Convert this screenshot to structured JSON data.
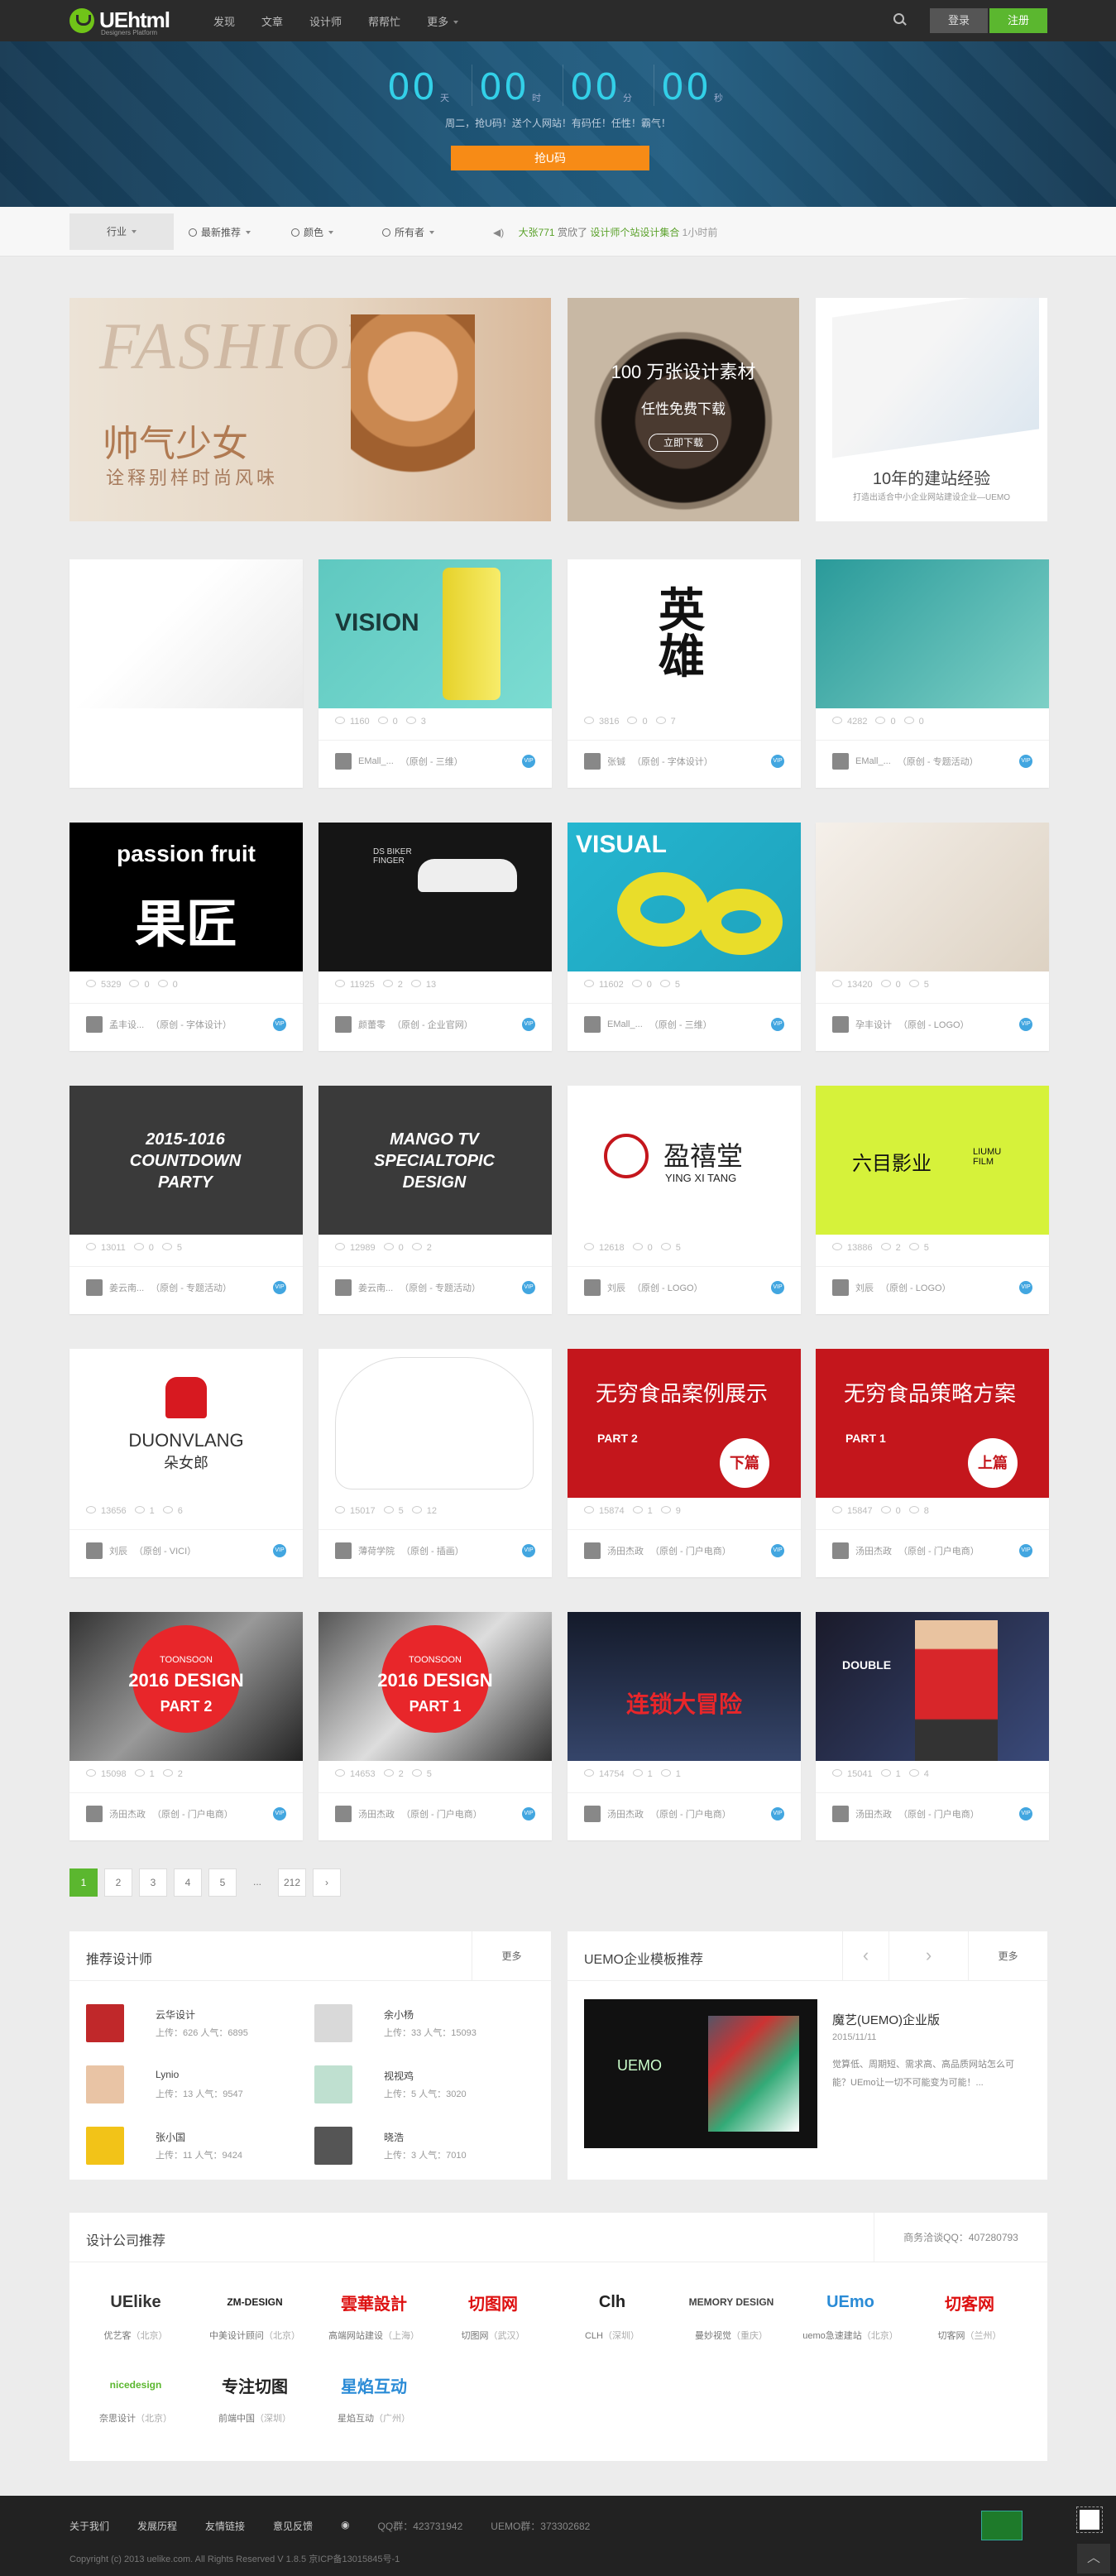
{
  "nav": {
    "logo": "UEhtml",
    "logo_sub": "Designers Platform",
    "items": [
      "发现",
      "文章",
      "设计师",
      "帮帮忙",
      "更多"
    ],
    "login": "登录",
    "register": "注册"
  },
  "banner": {
    "countdown": [
      {
        "num": "00",
        "unit": "天"
      },
      {
        "num": "00",
        "unit": "时"
      },
      {
        "num": "00",
        "unit": "分"
      },
      {
        "num": "00",
        "unit": "秒"
      }
    ],
    "subtitle": "周二，抢U码！送个人网站！有码任！任性！霸气！",
    "button": "抢U码"
  },
  "filter": {
    "industry": "行业",
    "recommend": "最新推荐",
    "color": "颜色",
    "owner": "所有者",
    "notice_user": "大张771",
    "notice_action": "赏欣了",
    "notice_item": "设计师个站设计集合",
    "notice_time": "1小时前"
  },
  "ads": {
    "fashion_title": "帅气少女",
    "fashion_sub": "诠释别样时尚风味",
    "fashion_bg": "FASHION",
    "material_title": "100 万张设计素材",
    "material_sub": "任性免费下载",
    "material_btn": "立即下载",
    "exp_title": "10年的建站经验",
    "exp_sub": "打造出适合中小企业网站建设企业—UEMO"
  },
  "cards": [
    {
      "title": "",
      "views": "",
      "likes": "",
      "comments": "",
      "author": "",
      "cat": ""
    },
    {
      "title": "VISION",
      "views": "1160",
      "comments": "0",
      "likes": "3",
      "author": "EMall_...",
      "cat": "（原创 - 三维）"
    },
    {
      "title": "英雄",
      "views": "3816",
      "comments": "0",
      "likes": "7",
      "author": "张铖",
      "cat": "（原创 - 字体设计）"
    },
    {
      "title": "",
      "views": "4282",
      "comments": "0",
      "likes": "0",
      "author": "EMall_...",
      "cat": "（原创 - 专题活动）"
    },
    {
      "title": "passion fruit",
      "sub": "果匠",
      "views": "5329",
      "comments": "0",
      "likes": "0",
      "author": "孟丰设...",
      "cat": "（原创 - 字体设计）"
    },
    {
      "title": "DS BIKER FINGER",
      "views": "11925",
      "comments": "2",
      "likes": "13",
      "author": "颜蕾零",
      "cat": "（原创 - 企业官网）"
    },
    {
      "title": "VISUAL",
      "views": "11602",
      "comments": "0",
      "likes": "5",
      "author": "EMall_...",
      "cat": "（原创 - 三维）"
    },
    {
      "title": "",
      "views": "13420",
      "comments": "0",
      "likes": "5",
      "author": "孕丰设计",
      "cat": "（原创 - LOGO）"
    },
    {
      "title": "2015-1016 COUNTDOWN PARTY",
      "views": "13011",
      "comments": "0",
      "likes": "5",
      "author": "姜云南...",
      "cat": "（原创 - 专题活动）"
    },
    {
      "title": "MANGO TV SPECIALTOPIC DESIGN",
      "views": "12989",
      "comments": "0",
      "likes": "2",
      "author": "姜云南...",
      "cat": "（原创 - 专题活动）"
    },
    {
      "title": "盈禧堂",
      "sub": "YING XI TANG",
      "views": "12618",
      "comments": "0",
      "likes": "5",
      "author": "刘辰",
      "cat": "（原创 - LOGO）"
    },
    {
      "title": "六目影业",
      "sub": "LIUMU FILM",
      "views": "13886",
      "comments": "2",
      "likes": "5",
      "author": "刘辰",
      "cat": "（原创 - LOGO）"
    },
    {
      "title": "DUONVLANG",
      "sub": "朵女郎",
      "views": "13656",
      "comments": "1",
      "likes": "6",
      "author": "刘辰",
      "cat": "（原创 - VICI）"
    },
    {
      "title": "",
      "views": "15017",
      "comments": "5",
      "likes": "12",
      "author": "薄荷学院",
      "cat": "（原创 - 插画）"
    },
    {
      "title": "无穷食品案例展示",
      "sub": "下篇",
      "part": "PART 2",
      "views": "15874",
      "comments": "1",
      "likes": "9",
      "author": "汤田杰政",
      "cat": "（原创 - 门户电商）"
    },
    {
      "title": "无穷食品策略方案",
      "sub": "上篇",
      "part": "PART 1",
      "views": "15847",
      "comments": "0",
      "likes": "8",
      "author": "汤田杰政",
      "cat": "（原创 - 门户电商）"
    },
    {
      "title": "2016 DESIGN",
      "part": "PART 2",
      "brand": "TOONSOON",
      "views": "15098",
      "comments": "1",
      "likes": "2",
      "author": "汤田杰政",
      "cat": "（原创 - 门户电商）"
    },
    {
      "title": "2016 DESIGN",
      "part": "PART 1",
      "brand": "TOONSOON",
      "views": "14653",
      "comments": "2",
      "likes": "5",
      "author": "汤田杰政",
      "cat": "（原创 - 门户电商）"
    },
    {
      "title": "连锁大冒险",
      "views": "14754",
      "comments": "1",
      "likes": "1",
      "author": "汤田杰政",
      "cat": "（原创 - 门户电商）"
    },
    {
      "title": "DOUBLE",
      "views": "15041",
      "comments": "1",
      "likes": "4",
      "author": "汤田杰政",
      "cat": "（原创 - 门户电商）"
    }
  ],
  "pager": [
    "1",
    "2",
    "3",
    "4",
    "5",
    "...",
    "212"
  ],
  "designers": {
    "title": "推荐设计师",
    "more": "更多",
    "list": [
      {
        "name": "云华设计",
        "meta": "上传：626   人气：6895",
        "color": "#c0282a"
      },
      {
        "name": "余小杨",
        "meta": "上传：33   人气：15093",
        "color": "#d9d9d9"
      },
      {
        "name": "Lynio",
        "meta": "上传：13   人气：9547",
        "color": "#e9c4a5"
      },
      {
        "name": "视视鸡",
        "meta": "上传：5   人气：3020",
        "color": "#bfe0d0"
      },
      {
        "name": "张小国",
        "meta": "上传：11   人气：9424",
        "color": "#f2c318"
      },
      {
        "name": "晓浩",
        "meta": "上传：3   人气：7010",
        "color": "#555555"
      }
    ]
  },
  "uemo": {
    "title": "UEMO企业模板推荐",
    "more": "更多",
    "item_title": "魔艺(UEMO)企业版",
    "item_date": "2015/11/11",
    "item_desc": "觉算低、周期短、需求高、高品质网站怎么可能？UEmo让一切不可能变为可能！...",
    "shot_text": "UEMO"
  },
  "companies": {
    "title": "设计公司推荐",
    "qq": "商务洽谈QQ：407280793",
    "list": [
      {
        "logo": "UElike",
        "name": "优艺客",
        "city": "（北京）",
        "color": "#333"
      },
      {
        "logo": "ZM-DESIGN",
        "name": "中美设计顾问",
        "city": "（北京）",
        "color": "#222"
      },
      {
        "logo": "雲華設計",
        "name": "高端网站建设",
        "city": "（上海）",
        "color": "#d11"
      },
      {
        "logo": "切图网",
        "name": "切图网",
        "city": "（武汉）",
        "color": "#d11"
      },
      {
        "logo": "Clh",
        "name": "CLH",
        "city": "（深圳）",
        "color": "#222"
      },
      {
        "logo": "MEMORY DESIGN",
        "name": "曼妙视觉",
        "city": "（重庆）",
        "color": "#444"
      },
      {
        "logo": "UEmo",
        "name": "uemo急速建站",
        "city": "（北京）",
        "color": "#2a8bd6"
      },
      {
        "logo": "切客网",
        "name": "切客网",
        "city": "（兰州）",
        "color": "#d11"
      },
      {
        "logo": "nicedesign",
        "name": "奈思设计",
        "city": "（北京）",
        "color": "#5bb72f"
      },
      {
        "logo": "专注切图",
        "name": "前端中国",
        "city": "（深圳）",
        "color": "#222"
      },
      {
        "logo": "星焰互动",
        "name": "星焰互动",
        "city": "（广州）",
        "color": "#2a8bd6"
      }
    ]
  },
  "footer": {
    "links": [
      "关于我们",
      "发展历程",
      "友情链接",
      "意见反馈",
      "QQ群：423731942",
      "UEMO群：373302682"
    ],
    "copyright": "Copyright (c) 2013 uelike.com. All Rights Reserved V 1.8.5 京ICP备13015845号-1"
  }
}
